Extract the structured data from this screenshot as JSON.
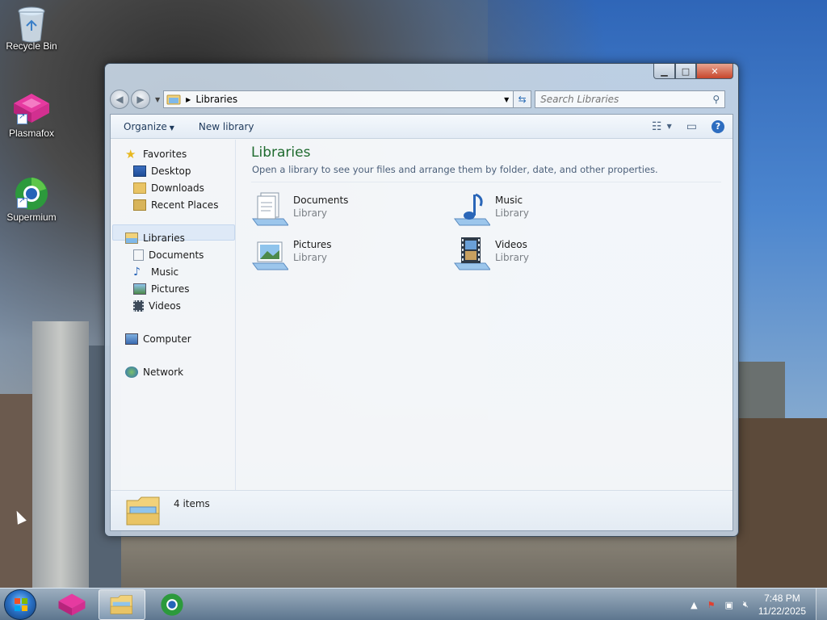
{
  "desktop": {
    "icons": [
      {
        "label": "Recycle Bin",
        "icon": "recycle-bin-icon"
      },
      {
        "label": "Plasmafox",
        "icon": "plasmafox-icon"
      },
      {
        "label": "Supermium",
        "icon": "supermium-icon"
      }
    ]
  },
  "window": {
    "address": {
      "path": "Libraries"
    },
    "search": {
      "placeholder": "Search Libraries"
    },
    "toolbar": {
      "organize": "Organize",
      "new_library": "New library"
    },
    "nav": {
      "favorites": "Favorites",
      "desktop": "Desktop",
      "downloads": "Downloads",
      "recent_places": "Recent Places",
      "libraries": "Libraries",
      "documents": "Documents",
      "music": "Music",
      "pictures": "Pictures",
      "videos": "Videos",
      "computer": "Computer",
      "network": "Network"
    },
    "main": {
      "title": "Libraries",
      "subtitle": "Open a library to see your files and arrange them by folder, date, and other properties.",
      "libraries": [
        {
          "name": "Documents",
          "type": "Library",
          "icon": "documents-library-icon"
        },
        {
          "name": "Music",
          "type": "Library",
          "icon": "music-library-icon"
        },
        {
          "name": "Pictures",
          "type": "Library",
          "icon": "pictures-library-icon"
        },
        {
          "name": "Videos",
          "type": "Library",
          "icon": "videos-library-icon"
        }
      ]
    },
    "details": {
      "count": "4 items"
    }
  },
  "taskbar": {
    "clock": {
      "time": "7:48 PM",
      "date": "11/22/2025"
    }
  },
  "colors": {
    "title_green": "#1e6a2e",
    "accent_blue": "#2d6dc0",
    "close_red": "#c7462c"
  }
}
